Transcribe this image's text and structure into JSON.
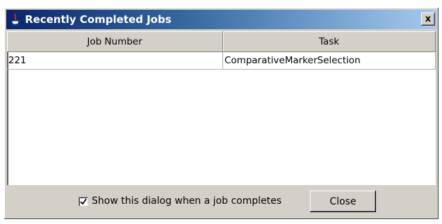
{
  "window": {
    "title": "Recently Completed Jobs",
    "close_label": "x"
  },
  "table": {
    "columns": [
      "Job Number",
      "Task"
    ],
    "rows": [
      [
        "221",
        "ComparativeMarkerSelection"
      ]
    ]
  },
  "footer": {
    "checkbox_label": "Show this dialog when a job completes",
    "checkbox_checked": true,
    "close_button_label": "Close"
  },
  "icons": {
    "app": "java-cup-icon",
    "checkmark": "checkmark-icon"
  }
}
